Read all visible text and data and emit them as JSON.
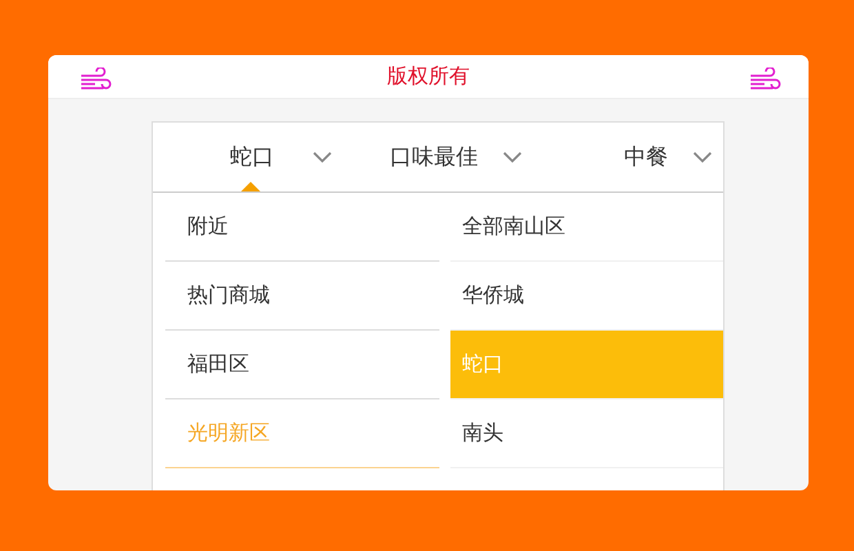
{
  "header": {
    "title": "版权所有"
  },
  "tabs": [
    {
      "label": "蛇口",
      "selected": true
    },
    {
      "label": "口味最佳",
      "selected": false
    },
    {
      "label": "中餐",
      "selected": false
    }
  ],
  "districts": [
    {
      "label": "附近",
      "selected": false
    },
    {
      "label": "热门商城",
      "selected": false
    },
    {
      "label": "福田区",
      "selected": false
    },
    {
      "label": "光明新区",
      "selected": true
    }
  ],
  "areas": [
    {
      "label": "全部南山区",
      "selected": false
    },
    {
      "label": "华侨城",
      "selected": false
    },
    {
      "label": "蛇口",
      "selected": true
    },
    {
      "label": "南头",
      "selected": false
    }
  ]
}
